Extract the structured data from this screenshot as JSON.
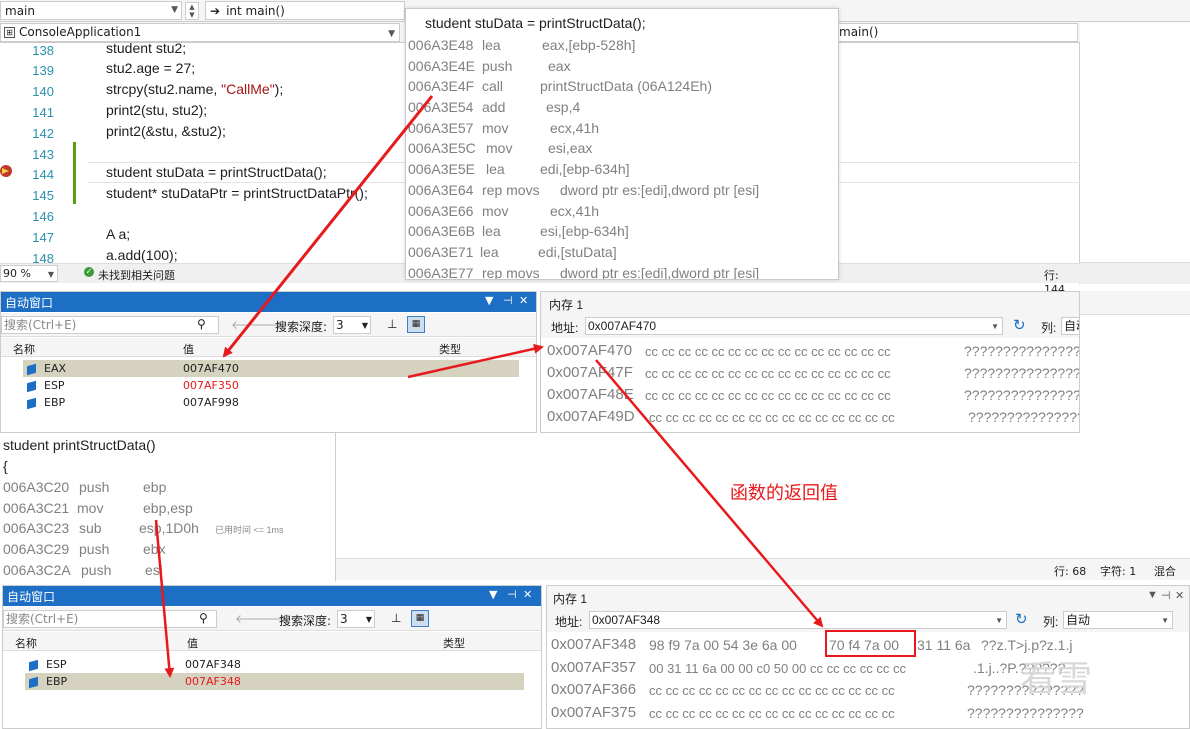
{
  "toolbar": {
    "scope_dropdown": "main",
    "function_dropdown": "int main()",
    "project_dropdown": "ConsoleApplication1",
    "member_dropdown": "main()"
  },
  "editor": {
    "lines": [
      {
        "no": "138",
        "code": "student stu2;"
      },
      {
        "no": "139",
        "code": "stu2.age = 27;"
      },
      {
        "no": "140",
        "code_pre": "strcpy(stu2.name, ",
        "code_str": "\"CallMe\"",
        "code_post": ");"
      },
      {
        "no": "141",
        "code": "print2(stu, stu2);"
      },
      {
        "no": "142",
        "code": "print2(&stu, &stu2);"
      },
      {
        "no": "143",
        "code": ""
      },
      {
        "no": "144",
        "code": "student stuData = printStructData();"
      },
      {
        "no": "145",
        "code": "student* stuDataPtr = printStructDataPtr();"
      },
      {
        "no": "146",
        "code": ""
      },
      {
        "no": "147",
        "code": "A a;"
      },
      {
        "no": "148",
        "code": "a.add(100);"
      }
    ],
    "zoom": "90 %",
    "status": "未找到相关问题",
    "line_indicator": "行: 144"
  },
  "disasm_top": {
    "header": "student stuData = printStructData();",
    "lines": [
      {
        "addr": "006A3E48",
        "op": "lea",
        "args": "eax,[ebp-528h]"
      },
      {
        "addr": "006A3E4E",
        "op": "push",
        "args": "eax"
      },
      {
        "addr": "006A3E4F",
        "op": "call",
        "args": "printStructData (06A124Eh)"
      },
      {
        "addr": "006A3E54",
        "op": "add",
        "args": "esp,4"
      },
      {
        "addr": "006A3E57",
        "op": "mov",
        "args": "ecx,41h"
      },
      {
        "addr": "006A3E5C",
        "op": "mov",
        "args": "esi,eax"
      },
      {
        "addr": "006A3E5E",
        "op": "lea",
        "args": "edi,[ebp-634h]"
      },
      {
        "addr": "006A3E64",
        "op": "rep movs",
        "args": "dword ptr es:[edi],dword ptr [esi]"
      },
      {
        "addr": "006A3E66",
        "op": "mov",
        "args": "ecx,41h"
      },
      {
        "addr": "006A3E6B",
        "op": "lea",
        "args": "esi,[ebp-634h]"
      },
      {
        "addr": "006A3E71",
        "op": "lea",
        "args": "edi,[stuData]"
      },
      {
        "addr": "006A3E77",
        "op": "rep movs",
        "args": "dword ptr es:[edi],dword ptr [esi]"
      }
    ]
  },
  "autos_top": {
    "title": "自动窗口",
    "search_placeholder": "搜索(Ctrl+E)",
    "depth_label": "搜索深度:",
    "depth_value": "3",
    "col_name": "名称",
    "col_value": "值",
    "col_type": "类型",
    "rows": [
      {
        "name": "EAX",
        "value": "007AF470",
        "changed": false
      },
      {
        "name": "ESP",
        "value": "007AF350",
        "changed": true
      },
      {
        "name": "EBP",
        "value": "007AF998",
        "changed": false
      }
    ]
  },
  "memory_top": {
    "title": "内存 1",
    "addr_label": "地址:",
    "addr_value": "0x007AF470",
    "col_label": "列:",
    "col_value": "自动",
    "rows": [
      {
        "addr": "0x007AF470",
        "bytes": "cc cc cc cc cc cc cc cc cc cc cc cc cc cc cc",
        "ascii": "???????????????"
      },
      {
        "addr": "0x007AF47F",
        "bytes": "cc cc cc cc cc cc cc cc cc cc cc cc cc cc cc",
        "ascii": "???????????????"
      },
      {
        "addr": "0x007AF48E",
        "bytes": "cc cc cc cc cc cc cc cc cc cc cc cc cc cc cc",
        "ascii": "???????????????"
      },
      {
        "addr": "0x007AF49D",
        "bytes": "cc cc cc cc cc cc cc cc cc cc cc cc cc cc cc",
        "ascii": "???????????????"
      }
    ]
  },
  "disasm_func": {
    "header": "student printStructData()",
    "brace": "{",
    "lines": [
      {
        "addr": "006A3C20",
        "op": "push",
        "args": "ebp"
      },
      {
        "addr": "006A3C21",
        "op": "mov",
        "args": "ebp,esp"
      },
      {
        "addr": "006A3C23",
        "op": "sub",
        "args": "esp,1D0h"
      },
      {
        "addr": "006A3C29",
        "op": "push",
        "args": "ebx"
      },
      {
        "addr": "006A3C2A",
        "op": "push",
        "args": "esi"
      }
    ],
    "elapsed": "已用时间 <= 1ms"
  },
  "status2": {
    "line": "行: 68",
    "char": "字符: 1",
    "mode": "混合"
  },
  "autos_bottom": {
    "title": "自动窗口",
    "search_placeholder": "搜索(Ctrl+E)",
    "depth_label": "搜索深度:",
    "depth_value": "3",
    "col_name": "名称",
    "col_value": "值",
    "col_type": "类型",
    "rows": [
      {
        "name": "ESP",
        "value": "007AF348",
        "changed": false
      },
      {
        "name": "EBP",
        "value": "007AF348",
        "changed": true
      }
    ]
  },
  "memory_bottom": {
    "title": "内存 1",
    "addr_label": "地址:",
    "addr_value": "0x007AF348",
    "col_label": "列:",
    "col_value": "自动",
    "rows": [
      {
        "addr": "0x007AF348",
        "bytes_pre": "98 f9 7a 00 54 3e 6a 00",
        "bytes_hl": "70 f4 7a 00",
        "bytes_post": "31 11 6a",
        "ascii": "??z.T>j.p?z.1.j"
      },
      {
        "addr": "0x007AF357",
        "bytes": "00 31 11 6a 00 00 c0 50 00 cc cc cc cc cc cc",
        "ascii": ".1.j..?P.??????"
      },
      {
        "addr": "0x007AF366",
        "bytes": "cc cc cc cc cc cc cc cc cc cc cc cc cc cc cc",
        "ascii": "???????????????"
      },
      {
        "addr": "0x007AF375",
        "bytes": "cc cc cc cc cc cc cc cc cc cc cc cc cc cc cc",
        "ascii": "???????????????"
      }
    ]
  },
  "annotation": "函数的返回值",
  "watermark": "看雪",
  "colors": {
    "accent": "#1c6fc4",
    "arrow": "#e8191c",
    "changed": "#e8191c"
  }
}
